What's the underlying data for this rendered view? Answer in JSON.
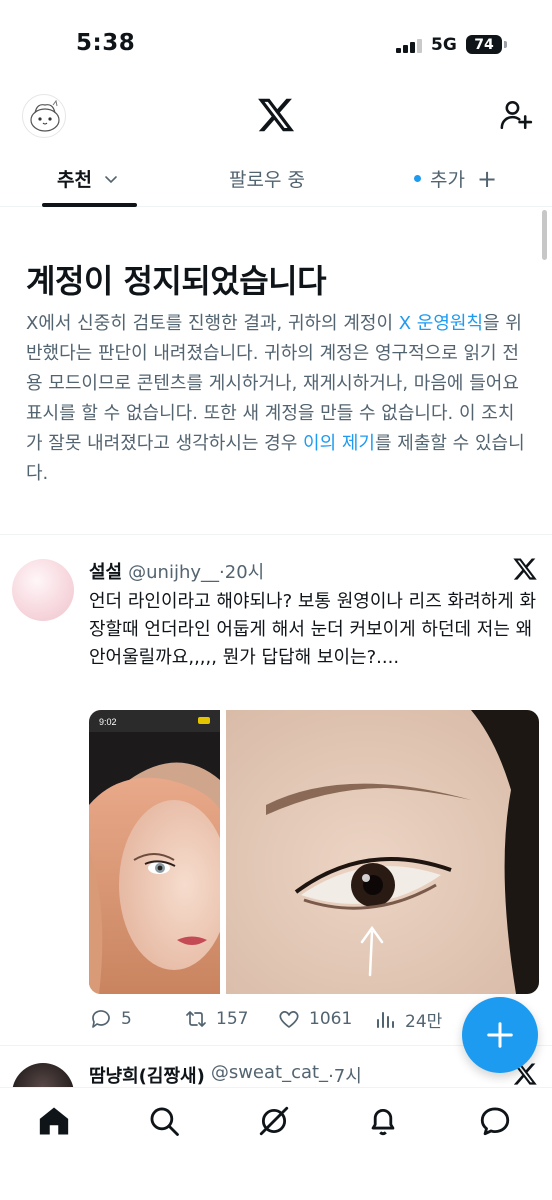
{
  "status_bar": {
    "time": "5:38",
    "network": "5G",
    "battery": "74"
  },
  "header": {
    "logo": "x-logo",
    "follow_icon": "add-person-icon"
  },
  "tabs": [
    {
      "label": "추천",
      "active": true
    },
    {
      "label": "팔로우 중",
      "active": false
    },
    {
      "label": "추가",
      "active": false
    }
  ],
  "notice": {
    "title": "계정이 정지되었습니다",
    "text_1": "X에서 신중히 검토를 진행한 결과, 귀하의 계정이 ",
    "link_rules": "X 운영원칙",
    "text_2": "을 위반했다는 판단이 내려졌습니다. 귀하의 계정은 영구적으로 읽기 전용 모드이므로 콘텐츠를 게시하거나, 재게시하거나, 마음에 들어요 표시를 할 수 없습니다. 또한 새 계정을 만들 수 없습니다. 이 조치가 잘못 내려졌다고 생각하시는 경우 ",
    "link_appeal": "이의 제기",
    "text_3": "를 제출할 수 있습니다."
  },
  "tweet": {
    "name": "설설",
    "handle": "@unijhy__",
    "time": "·20시",
    "text": "언더 라인이라고 해야되나? 보통 원영이나 리즈 화려하게 화장할때 언더라인 어둡게 해서 눈더 커보이게 하던데 저는 왜 안어울릴까요,,,,, 뭔가 답답해 보이는?....",
    "media_1_time": "9:02",
    "replies": "5",
    "reposts": "157",
    "likes": "1061",
    "views": "24만"
  },
  "next_tweet": {
    "name": "땀냥희(김짱새)",
    "handle": "@sweat_cat_",
    "time": "·7시"
  },
  "colors": {
    "accent": "#1d9bf0",
    "text": "#0f1419",
    "secondary": "#536471"
  }
}
